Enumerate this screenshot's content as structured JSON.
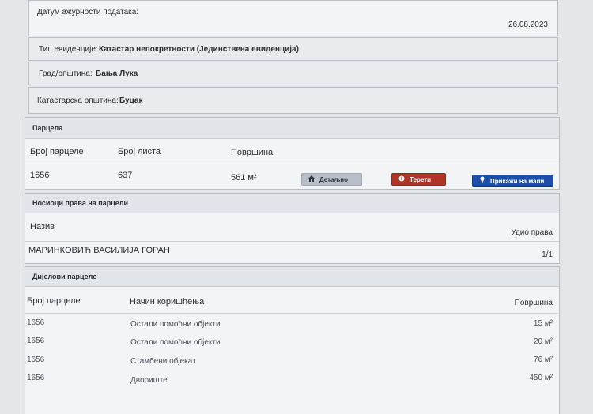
{
  "update_date": {
    "label": "Датум ажурности података:",
    "value": "26.08.2023"
  },
  "record_type": {
    "label": "Тип евиденције:",
    "value": "Катастар непокретности (Јединствена евиденција)"
  },
  "city": {
    "label": "Град/општина:",
    "value": "Бања Лука"
  },
  "cadastral_municipality": {
    "label": "Катастарска општина:",
    "value": "Буцак"
  },
  "parcel": {
    "title": "Парцела",
    "headers": {
      "number": "Број парцеле",
      "sheet": "Број листа",
      "area": "Површина"
    },
    "row": {
      "number": "1656",
      "sheet": "637",
      "area": "561 м²"
    },
    "buttons": {
      "details": "Детаљно",
      "encumbrances": "Терети",
      "map": "Прикажи на мапи"
    }
  },
  "rights_holders": {
    "title": "Носиоци права на парцели",
    "headers": {
      "name": "Назив",
      "share": "Удио права"
    },
    "rows": [
      {
        "name": "МАРИНКОВИЋ ВАСИЛИЈА ГОРАН",
        "share": "1/1"
      }
    ]
  },
  "parts": {
    "title": "Дијелови парцеле",
    "headers": {
      "number": "Број парцеле",
      "usage": "Начин коришћења",
      "area": "Површина"
    },
    "rows": [
      {
        "number": "1656",
        "usage": "Остали помоћни објекти",
        "area": "15 м²"
      },
      {
        "number": "1656",
        "usage": "Остали помоћни објекти",
        "area": "20 м²"
      },
      {
        "number": "1656",
        "usage": "Стамбени објекат",
        "area": "76 м²"
      },
      {
        "number": "1656",
        "usage": "Двориште",
        "area": "450 м²"
      }
    ]
  },
  "colors": {
    "details_button": "#b9bfc7",
    "encumbrances_button": "#b03527",
    "map_button": "#1d4fa8"
  },
  "icons": {
    "details": "home-icon",
    "encumbrances": "alert-circle-icon",
    "map": "map-pin-icon"
  }
}
